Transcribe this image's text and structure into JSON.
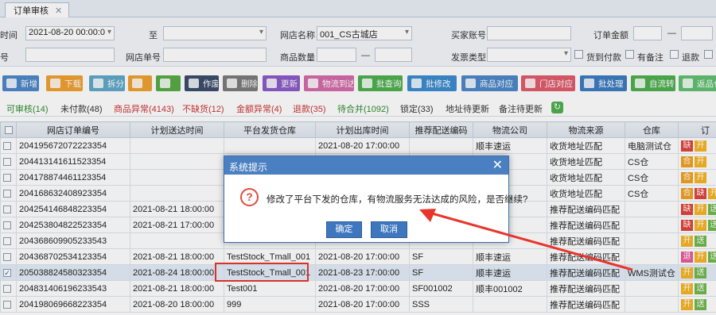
{
  "tab": {
    "title": "订单审核",
    "close": "✕"
  },
  "filters": {
    "time_label": "时间",
    "date_from": "2021-08-20 00:00:0",
    "to_label": "至",
    "shop_name_label": "网店名称",
    "shop_name_value": "001_CS古城店",
    "buyer_account_label": "买家账号",
    "order_amount_label": "订单金额",
    "dash1": "—",
    "no_label": "号",
    "shop_order_label": "网店单号",
    "goods_qty_label": "商品数量",
    "dash2": "—",
    "invoice_type_label": "发票类型",
    "cod_label": "货到付款",
    "remark_label": "有备注",
    "refund_label": "退款"
  },
  "toolbar": [
    {
      "label": "新增",
      "color": "#4a86c8"
    },
    {
      "label": "下载",
      "color": "#f0a030"
    },
    {
      "label": "拆分",
      "color": "#5fa8c8"
    },
    {
      "label": "",
      "color": "#f0a030"
    },
    {
      "label": "",
      "color": "#55aa44"
    },
    {
      "label": "作废",
      "color": "#3a4a6a"
    },
    {
      "label": "删除",
      "color": "#7a7a7a"
    },
    {
      "label": "更新",
      "color": "#8a5ac8"
    },
    {
      "label": "物流到达",
      "color": "#d46aa8"
    },
    {
      "label": "批查询",
      "color": "#4cae4c"
    },
    {
      "label": "批修改",
      "color": "#3a8ad0"
    },
    {
      "label": "商品对应",
      "color": "#4a86c8"
    },
    {
      "label": "门店对应",
      "color": "#e05a6a"
    },
    {
      "label": "批处理",
      "color": "#3a7ac0"
    },
    {
      "label": "自流转",
      "color": "#4cae4c"
    },
    {
      "label": "返品仓",
      "color": "#5fbf6f"
    }
  ],
  "status_tabs": [
    {
      "label": "可审核(14)",
      "color": "#2e8b2e"
    },
    {
      "label": "未付款(48)",
      "color": "#333333"
    },
    {
      "label": "商品异常(4143)",
      "color": "#cc3333"
    },
    {
      "label": "不缺货(12)",
      "color": "#cc3333"
    },
    {
      "label": "金额异常(4)",
      "color": "#cc3333"
    },
    {
      "label": "退款(35)",
      "color": "#cc3333"
    },
    {
      "label": "待合并(1092)",
      "color": "#2e8b2e"
    },
    {
      "label": "锁定(33)",
      "color": "#333333"
    },
    {
      "label": "地址待更新",
      "color": "#333333"
    },
    {
      "label": "备注待更新",
      "color": "#333333"
    }
  ],
  "refresh_icon": "refresh-icon",
  "table": {
    "columns": [
      "网店订单编号",
      "计划送达时间",
      "平台发货仓库",
      "计划出库时间",
      "推荐配送编码",
      "物流公司",
      "物流来源",
      "仓库",
      "订"
    ],
    "rows": [
      {
        "no": "204195672072223354",
        "checked": false,
        "c1": "",
        "c2": "",
        "c3": "2021-08-20 17:00:00",
        "c4": "",
        "c5": "顺丰速运",
        "c6": "收货地址匹配",
        "c7": "电脑测试仓",
        "badges": [
          {
            "t": "缺",
            "c": "b-red"
          },
          {
            "t": "开",
            "c": "b-amber"
          }
        ]
      },
      {
        "no": "204413141611523354",
        "checked": false,
        "c1": "",
        "c2": "",
        "c3": "",
        "c4": "",
        "c5": "",
        "c6": "收货地址匹配",
        "c7": "CS仓",
        "badges": [
          {
            "t": "合",
            "c": "b-orange"
          },
          {
            "t": "开",
            "c": "b-amber"
          }
        ]
      },
      {
        "no": "204178874461123354",
        "checked": false,
        "c1": "",
        "c2": "",
        "c3": "",
        "c4": "",
        "c5": "",
        "c6": "收货地址匹配",
        "c7": "CS仓",
        "badges": [
          {
            "t": "合",
            "c": "b-orange"
          },
          {
            "t": "开",
            "c": "b-amber"
          }
        ]
      },
      {
        "no": "204168632408923354",
        "checked": false,
        "c1": "",
        "c2": "",
        "c3": "",
        "c4": "",
        "c5": "",
        "c6": "收货地址匹配",
        "c7": "CS仓",
        "badges": [
          {
            "t": "合",
            "c": "b-orange"
          },
          {
            "t": "缺",
            "c": "b-red"
          },
          {
            "t": "开",
            "c": "b-amber"
          }
        ]
      },
      {
        "no": "204254146848223354",
        "checked": false,
        "c1": "2021-08-21 18:00:00",
        "c2": "",
        "c3": "",
        "c4": "",
        "c5": "",
        "c6": "推荐配送编码匹配",
        "c7": "",
        "badges": [
          {
            "t": "缺",
            "c": "b-red"
          },
          {
            "t": "开",
            "c": "b-amber"
          },
          {
            "t": "送",
            "c": "b-green"
          }
        ]
      },
      {
        "no": "204253804822523354",
        "checked": false,
        "c1": "2021-08-21 17:00:00",
        "c2": "",
        "c3": "",
        "c4": "",
        "c5": "",
        "c6": "推荐配送编码匹配",
        "c7": "",
        "badges": [
          {
            "t": "缺",
            "c": "b-red"
          },
          {
            "t": "开",
            "c": "b-amber"
          },
          {
            "t": "送",
            "c": "b-green"
          }
        ]
      },
      {
        "no": "204368609905233543",
        "checked": false,
        "c1": "",
        "c2": "",
        "c3": "",
        "c4": "",
        "c5": "",
        "c6": "推荐配送编码匹配",
        "c7": "",
        "badges": [
          {
            "t": "开",
            "c": "b-amber"
          },
          {
            "t": "送",
            "c": "b-green"
          }
        ]
      },
      {
        "no": "204368702534123354",
        "checked": false,
        "c1": "2021-08-21 18:00:00",
        "c2": "TestStock_Tmall_001",
        "c3": "2021-08-20 17:00:00",
        "c4": "SF",
        "c5": "顺丰速运",
        "c6": "推荐配送编码匹配",
        "c7": "",
        "badges": [
          {
            "t": "退",
            "c": "b-pink"
          },
          {
            "t": "开",
            "c": "b-amber"
          },
          {
            "t": "送",
            "c": "b-green"
          }
        ]
      },
      {
        "no": "205038824580323354",
        "checked": true,
        "c1": "2021-08-24 18:00:00",
        "c2": "TestStock_Tmall_001",
        "c3": "2021-08-23 17:00:00",
        "c4": "SF",
        "c5": "顺丰速运",
        "c6": "推荐配送编码匹配",
        "c7": "WMS测试仓",
        "badges": [
          {
            "t": "开",
            "c": "b-amber"
          },
          {
            "t": "送",
            "c": "b-green"
          }
        ]
      },
      {
        "no": "204831406196233543",
        "checked": false,
        "c1": "2021-08-21 18:00:00",
        "c2": "Test001",
        "c3": "2021-08-20 17:00:00",
        "c4": "SF001002",
        "c5": "顺丰001002",
        "c6": "推荐配送编码匹配",
        "c7": "",
        "badges": [
          {
            "t": "开",
            "c": "b-amber"
          },
          {
            "t": "送",
            "c": "b-green"
          }
        ]
      },
      {
        "no": "204198069668223354",
        "checked": false,
        "c1": "2021-08-20 18:00:00",
        "c2": "999",
        "c3": "2021-08-20 17:00:00",
        "c4": "SSS",
        "c5": "",
        "c6": "推荐配送编码匹配",
        "c7": "",
        "badges": [
          {
            "t": "开",
            "c": "b-amber"
          },
          {
            "t": "送",
            "c": "b-green"
          }
        ]
      }
    ]
  },
  "dialog": {
    "title": "系统提示",
    "close": "✕",
    "icon": "?",
    "message": "修改了平台下发的仓库，有物流服务无法达成的风险，是否继续?",
    "ok": "确定",
    "cancel": "取消"
  },
  "annotation_color": "#e8352c"
}
